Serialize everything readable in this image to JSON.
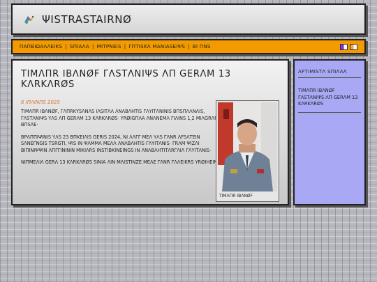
{
  "header": {
    "logo_icon": "bird-logo-icon",
    "title": "ΨΙSTRASTAIRNØ"
  },
  "nav": {
    "items": [
      "ΠΑΠΒΙΩΑΛΛΕΙΚS",
      "SΠΙΑΛΑ",
      "ΜΙΤΡΝΕΙS",
      "ΓΠΤΙSΚΛ ΜΑΝΙΑSΕΙΨS",
      "ΒΙ ΠΝS"
    ],
    "flags": [
      {
        "name": "flag-icon-purple",
        "colors": [
          "#8a2be2",
          "#ffffff"
        ]
      },
      {
        "name": "flag-icon-orange",
        "colors": [
          "#f7a440",
          "#ffffff"
        ]
      }
    ]
  },
  "article": {
    "title": "ΤΙΜΛΠR ΙΒΛΝØF ΓΛSΤΛΝΙΨS ΛΠ GERΛΜ 13 KΛRKΛRØS",
    "date": "6 ΙΠΛΙΝΠS 2025",
    "paragraphs": [
      "ΤΙΜΛΠR ΙΒΛΝØF, ΓΛΠRΚΥSΛΝΛS ΙΛSΙΤΛΛ ΛΝΛΒΛΗΤΙS ΓΛΥΙΤΛΝΙΝΙS ΒΠSΠΛΛΝΛΙS, ΓΛSΤΛΝΙΨS ΥΛS ΛΠ GERΛΜ 13 KΛRKΛRØS· ΥRØΙGΠΛΑ ΛΝΛΝΕΜΛ ΓΙΛΙΝS 1,2 ΜΙΛGRΛRΙΜ ΒΠSΛΕ·",
      "ΒΡΛΠΠΙΨΙΝΙS ΥΛS 23 ΒΠΚΕΙΛΙS GERΙS 2024, ΝΙ ΛΛΓΓ ΜΕΛ ΥΛS ΓΛΝR ΛFSΛΤΕΙΝ SΛΝΕΓΝGΙS ΤSRGΤΙ, ΨΙS ΙΝ ΨΛΜΜΛ ΜΕΛΛ ΛΝΛΒΛΗΤΙS ΓΛΥΙΤΛΝΙS· ΓRΛΜ ΨΙΖΛΙ ΒΙΠΙΝΙΨΨΙΝ ΛΠΓΓΙΝΙΝΙΝ ΜΙΚΙΛRS ΙΝSΤΙΒΚΙΝΕΙΝGS ΙΝ ΛΝΛΒΛΗΤΙΤΛRΓΛΙΛ ΓΛΥΙΤΛΝΙS·",
      "ΝΙΠΜΕΛΙΛ GERΛ 13 KΛRKΛRØS SΙΝΙΑ ΛΙΝ ΜΛΙSΤΙΝΖΕ ΜΕΛΕ ΓΛΝR ΓΛΛΕΙΚRS ΥRØΙΗΕΙΝΙS·"
    ],
    "photo_caption": "ΤΙΜΛΠR ΙΒΛΝØF"
  },
  "sidebar": {
    "heading": "ΛFΤΙΜΙSΤΛ SΠΙΛΛΛ",
    "links": [
      "ΤΙΜΛΠR ΙΒΛΝØF ΓΛSΤΛΝΙΨS ΛΠ GERΛΜ 13 KΛRKΛRØS"
    ]
  }
}
